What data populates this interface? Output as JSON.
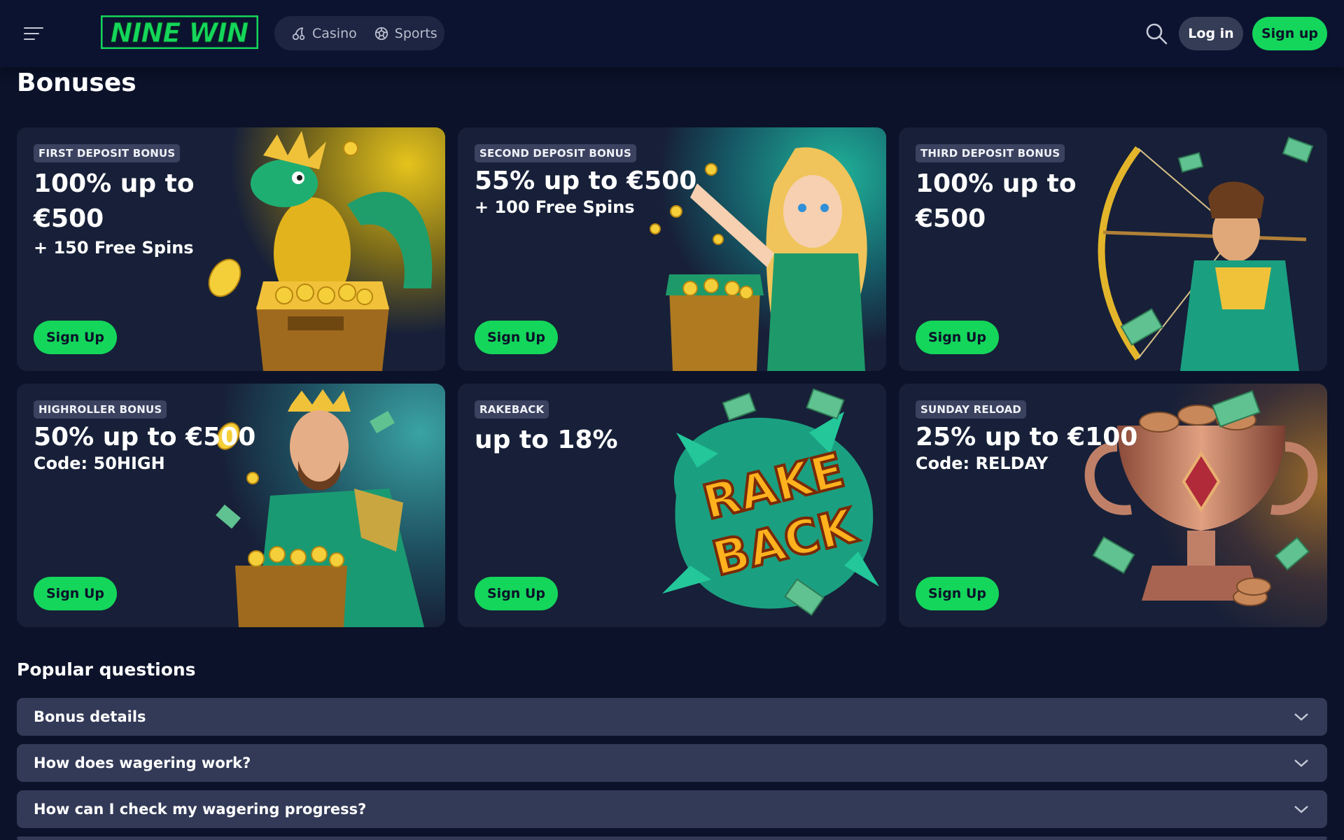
{
  "header": {
    "logo_text": "NINE WIN",
    "nav": [
      {
        "label": "Casino",
        "icon": "cherry-icon"
      },
      {
        "label": "Sports",
        "icon": "soccer-ball-icon"
      }
    ],
    "login_label": "Log in",
    "signup_label": "Sign up"
  },
  "page_title": "Bonuses",
  "cards": [
    {
      "badge": "FIRST DEPOSIT BONUS",
      "title": "100% up to €500",
      "sub": "+ 150 Free Spins",
      "cta": "Sign Up",
      "art": "dragon-treasure"
    },
    {
      "badge": "SECOND DEPOSIT BONUS",
      "title": "55% up to €500",
      "sub": "+ 100 Free Spins",
      "cta": "Sign Up",
      "art": "heroine-treasure"
    },
    {
      "badge": "THIRD DEPOSIT BONUS",
      "title": "100% up to €500",
      "sub": "",
      "cta": "Sign Up",
      "art": "archer"
    },
    {
      "badge": "HIGHROLLER BONUS",
      "title": "50% up to €500",
      "sub": "Code: 50HIGH",
      "cta": "Sign Up",
      "art": "king-treasure"
    },
    {
      "badge": "RAKEBACK",
      "title": "up to 18%",
      "sub": "",
      "cta": "Sign Up",
      "art": "rakeback-text"
    },
    {
      "badge": "SUNDAY RELOAD",
      "title": "25% up to €100",
      "sub": "Code: RELDAY",
      "cta": "Sign Up",
      "art": "trophy"
    }
  ],
  "rakeback_art_text": [
    "RAKE",
    "BACK"
  ],
  "faq": {
    "title": "Popular questions",
    "items": [
      "Bonus details",
      "How does wagering work?",
      "How can I check my wagering progress?"
    ]
  },
  "colors": {
    "accent": "#14d65b",
    "bg": "#0b1229",
    "card": "#172038",
    "faq": "#323a57"
  }
}
